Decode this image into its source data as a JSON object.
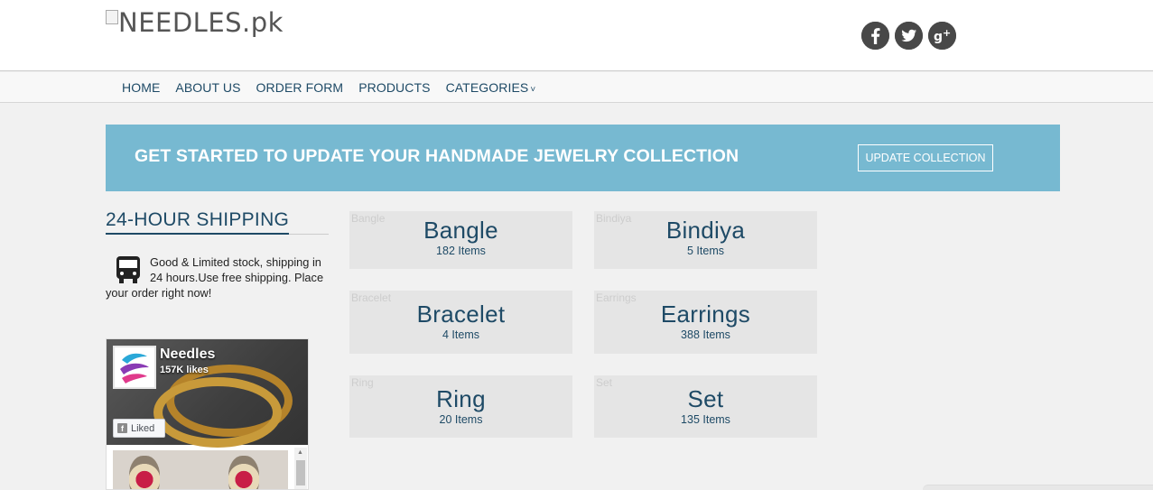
{
  "header": {
    "logo_alt": "NEEDLES.pk",
    "social": [
      {
        "icon": "facebook-icon",
        "glyph": "f"
      },
      {
        "icon": "twitter-icon",
        "glyph": "t"
      },
      {
        "icon": "google-plus-icon",
        "glyph": "g+"
      }
    ]
  },
  "nav": {
    "items": [
      "HOME",
      "ABOUT US",
      "ORDER FORM",
      "PRODUCTS",
      "CATEGORIES"
    ]
  },
  "banner": {
    "text": "GET STARTED TO UPDATE YOUR HANDMADE JEWELRY COLLECTION",
    "button": "UPDATE COLLECTION",
    "background": "#77b9d1"
  },
  "sidebar": {
    "title": "24-HOUR SHIPPING",
    "shipping_text": "Good & Limited stock, shipping in 24 hours.Use free shipping. Place your order right now!"
  },
  "facebook": {
    "page_name": "Needles",
    "likes": "157K likes",
    "liked_label": "Liked"
  },
  "categories": [
    {
      "alt": "Bangle",
      "name": "Bangle",
      "count": "182 Items"
    },
    {
      "alt": "Bindiya",
      "name": "Bindiya",
      "count": "5 Items"
    },
    {
      "alt": "Bracelet",
      "name": "Bracelet",
      "count": "4 Items"
    },
    {
      "alt": "Earrings",
      "name": "Earrings",
      "count": "388 Items"
    },
    {
      "alt": "Ring",
      "name": "Ring",
      "count": "20 Items"
    },
    {
      "alt": "Set",
      "name": "Set",
      "count": "135 Items"
    }
  ],
  "colors": {
    "accent": "#1e4a66",
    "tile": "#e5e5e5"
  }
}
